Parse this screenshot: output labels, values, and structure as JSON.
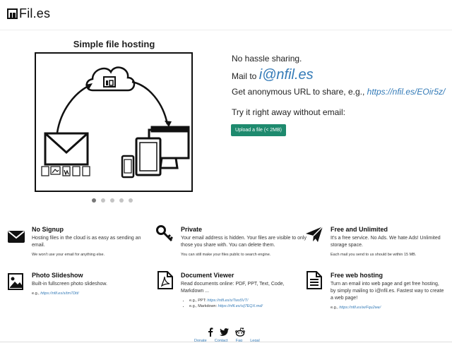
{
  "brand": {
    "name": "Fil.es"
  },
  "slider": {
    "title": "Simple file hosting",
    "slide_count": 5,
    "active_index": 0
  },
  "hero": {
    "line1": "No hassle sharing.",
    "mail_prefix": "Mail to ",
    "mail_address": "i@nfil.es",
    "anon_prefix": "Get anonymous URL to share, e.g., ",
    "anon_url": "https://nfil.es/EOir5z/",
    "try_text": "Try it right away without email:",
    "upload_label": "Upload a file (< 2MB)"
  },
  "features": {
    "no_signup": {
      "title": "No Signup",
      "desc": "Hosting files in the cloud is as easy as sending an email.",
      "note": "We won't use your email for anything else."
    },
    "private": {
      "title": "Private",
      "desc": "Your email address is hidden. Your files are visible to only those you share with. You can delete them.",
      "note": "You can still make your files public to search engine."
    },
    "free": {
      "title": "Free and Unlimited",
      "desc": "It's a free service. No Ads. We hate Ads! Unlimited storage space.",
      "note": "Each mail you send to us should be within 15 MB."
    },
    "slideshow": {
      "title": "Photo Slideshow",
      "desc": "Built-in fullscreen photo slideshow.",
      "note_prefix": "e.g., ",
      "note_link": "https://nfil.es/s/tm7Dtt/"
    },
    "viewer": {
      "title": "Document Viewer",
      "desc": "Read documents online: PDF, PPT, Text, Code, Markdown ...",
      "items": [
        {
          "prefix": "e.g., PPT: ",
          "link": "https://nfil.es/s/Tws5VT/"
        },
        {
          "prefix": "e.g., Markdown: ",
          "link": "https://nfil.es/s/j7EQX.md/"
        }
      ]
    },
    "webhost": {
      "title": "Free web hosting",
      "desc": "Turn an email into web page and get free hosting, by simply mailing to i@nfil.es. Fastest way to create a web page!",
      "note_prefix": "e.g., ",
      "note_link": "https://nfil.es/w/Fqu2we/"
    }
  },
  "footer": {
    "links": [
      "Donate",
      "Contact",
      "Faq",
      "Legal"
    ]
  }
}
